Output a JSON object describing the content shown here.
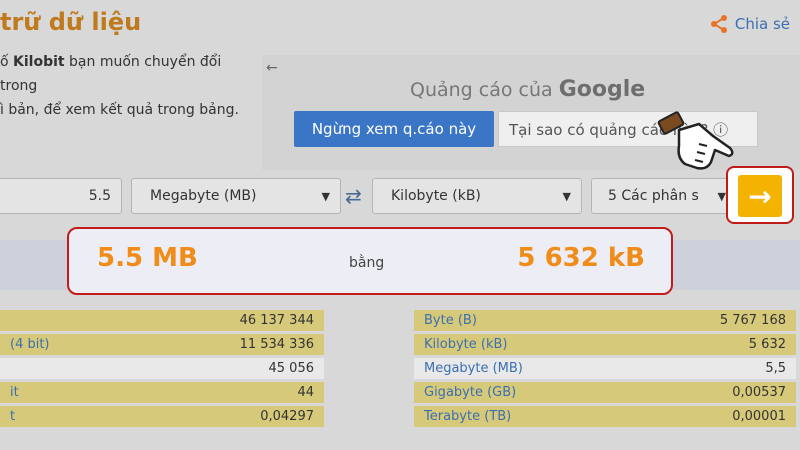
{
  "page": {
    "title": "trữ dữ liệu",
    "share_label": "Chia sẻ",
    "desc_pre": "ố ",
    "desc_bold": "Kilobit",
    "desc_post": " bạn muốn chuyển đổi trong",
    "desc_line2": "ì bản, để xem kết quả trong bảng."
  },
  "ad": {
    "back": "←",
    "title_pre": "Quảng cáo của ",
    "title_brand": "Google",
    "stop_label": "Ngừng xem q.cáo này",
    "why_label": "Tại sao có quảng cáo này? ⓘ"
  },
  "converter": {
    "input_value": "5.5",
    "from_unit": "Megabyte (MB)",
    "to_unit": "Kilobyte (kB)",
    "precision": "5 Các phân s",
    "go_label": "→"
  },
  "result": {
    "left": "5.5 MB",
    "middle": "bằng",
    "right": "5 632 kB"
  },
  "table_left": [
    {
      "label": "",
      "value": "46 137 344"
    },
    {
      "label": "(4 bit)",
      "value": "11 534 336"
    },
    {
      "label": "",
      "value": "45 056"
    },
    {
      "label": "it",
      "value": "44"
    },
    {
      "label": "t",
      "value": "0,04297"
    }
  ],
  "table_right": [
    {
      "label": "Byte (B)",
      "value": "5 767 168"
    },
    {
      "label": "Kilobyte (kB)",
      "value": "5 632"
    },
    {
      "label": "Megabyte (MB)",
      "value": "5,5"
    },
    {
      "label": "Gigabyte (GB)",
      "value": "0,00537"
    },
    {
      "label": "Terabyte (TB)",
      "value": "0,00001"
    }
  ],
  "colors": {
    "accent_orange": "#f08c1a",
    "go_yellow": "#f5b301",
    "highlight_red": "#c21b1b",
    "link_blue": "#3b6fb0",
    "ad_blue": "#3a76c5"
  }
}
